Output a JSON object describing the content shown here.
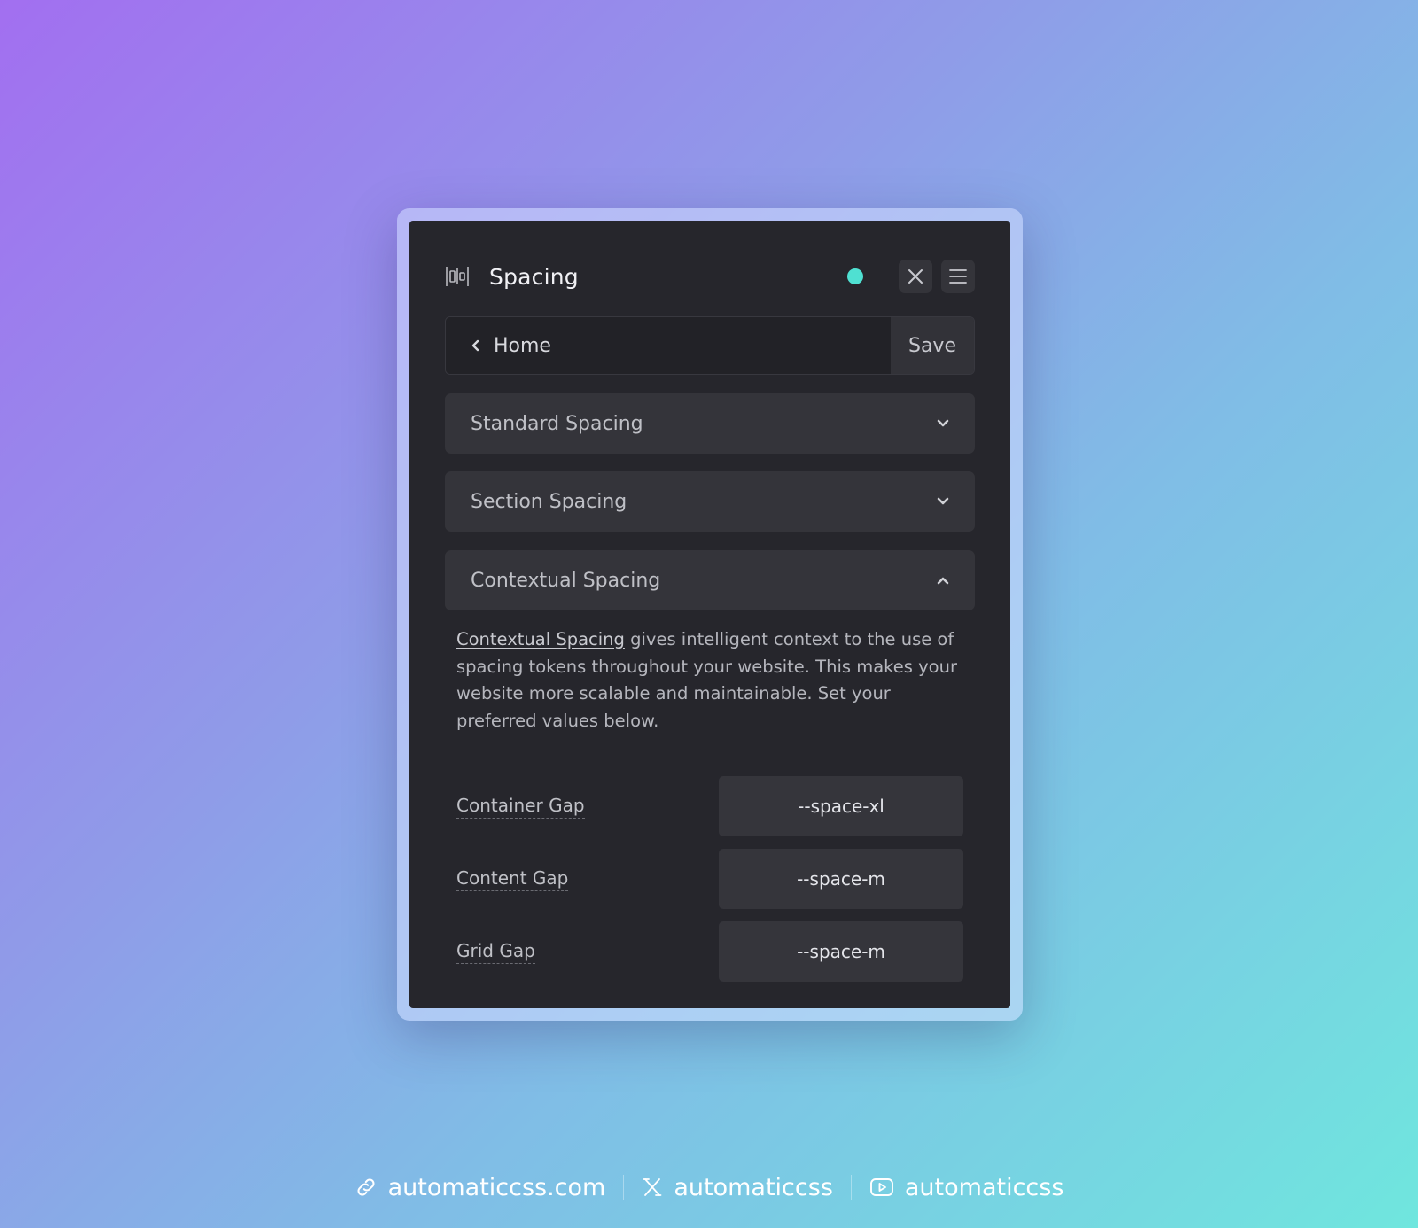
{
  "panel": {
    "title": "Spacing",
    "status_color": "#4fe0d2",
    "close_icon": "close-icon",
    "menu_icon": "hamburger-menu-icon"
  },
  "nav": {
    "home_label": "Home",
    "save_label": "Save"
  },
  "sections": [
    {
      "label": "Standard Spacing",
      "expanded": false
    },
    {
      "label": "Section Spacing",
      "expanded": false
    },
    {
      "label": "Contextual Spacing",
      "expanded": true
    }
  ],
  "contextual": {
    "link_text": "Contextual Spacing",
    "description": " gives intelligent context to the use of spacing tokens throughout your website. This makes your website more scalable and maintainable. Set your preferred values below.",
    "fields": [
      {
        "label": "Container Gap",
        "value": "--space-xl"
      },
      {
        "label": "Content Gap",
        "value": "--space-m"
      },
      {
        "label": "Grid Gap",
        "value": "--space-m"
      }
    ]
  },
  "footer": {
    "website": "automaticcss.com",
    "x_handle": "automaticcss",
    "youtube_handle": "automaticcss"
  }
}
